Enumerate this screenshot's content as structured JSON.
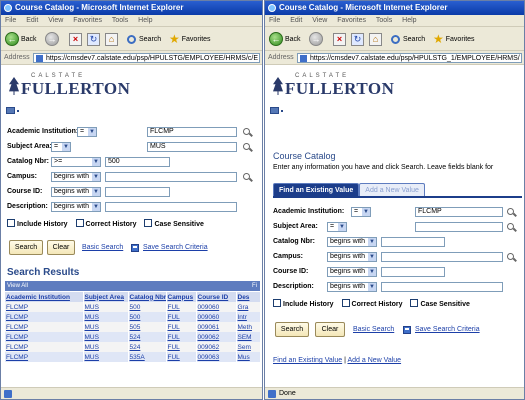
{
  "left_window": {
    "title": "Course Catalog - Microsoft Internet Explorer",
    "menu": [
      "File",
      "Edit",
      "View",
      "Favorites",
      "Tools",
      "Help"
    ],
    "toolbar": {
      "back_label": "Back",
      "search_label": "Search",
      "favorites_label": "Favorites"
    },
    "address": {
      "label": "Address",
      "url": "https://cmsdev7.calstate.edu/psp/HPULSTG/EMPLOYEE/HRMS/c/E"
    },
    "logo": {
      "small": "CALSTATE",
      "big": "FULLERTON"
    },
    "form": {
      "academic_institution": {
        "label": "Academic Institution:",
        "op": "=",
        "value": "FLCMP"
      },
      "subject_area": {
        "label": "Subject Area:",
        "op": "=",
        "value": "MUS"
      },
      "catalog_nbr": {
        "label": "Catalog Nbr:",
        "op": ">=",
        "value": "500"
      },
      "campus": {
        "label": "Campus:",
        "op": "begins with",
        "value": ""
      },
      "course_id": {
        "label": "Course ID:",
        "op": "begins with",
        "value": ""
      },
      "description": {
        "label": "Description:",
        "op": "begins with",
        "value": ""
      }
    },
    "checkboxes": [
      "Include History",
      "Correct History",
      "Case Sensitive"
    ],
    "buttons": {
      "search": "Search",
      "clear": "Clear"
    },
    "links": {
      "basic_search": "Basic Search",
      "save_search": "Save Search Criteria"
    },
    "results": {
      "title": "Search Results",
      "view_all": "View All",
      "columns": [
        "Academic Institution",
        "Subject Area",
        "Catalog Nbr",
        "Campus",
        "Course ID",
        "Des"
      ],
      "rows": [
        [
          "FLCMP",
          "MUS",
          "500",
          "FUL",
          "009060",
          "Gra"
        ],
        [
          "FLCMP",
          "MUS",
          "500",
          "FUL",
          "009060",
          "Intr"
        ],
        [
          "FLCMP",
          "MUS",
          "505",
          "FUL",
          "009061",
          "Meth"
        ],
        [
          "FLCMP",
          "MUS",
          "524",
          "FUL",
          "009062",
          "SEM"
        ],
        [
          "FLCMP",
          "MUS",
          "524",
          "FUL",
          "009062",
          "Sem"
        ],
        [
          "FLCMP",
          "MUS",
          "535A",
          "FUL",
          "009063",
          "Mus"
        ]
      ]
    }
  },
  "right_window": {
    "title": "Course Catalog - Microsoft Internet Explorer",
    "menu": [
      "File",
      "Edit",
      "View",
      "Favorites",
      "Tools",
      "Help"
    ],
    "toolbar": {
      "back_label": "Back",
      "search_label": "Search",
      "favorites_label": "Favorites"
    },
    "address": {
      "label": "Address",
      "url": "https://cmsdev7.calstate.edu/psp/HPULSTG_1/EMPLOYEE/HRMS/"
    },
    "logo": {
      "small": "CALSTATE",
      "big": "FULLERTON"
    },
    "heading": "Course Catalog",
    "help_text": "Enter any information you have and click Search. Leave fields blank for",
    "tabs": {
      "find": "Find an Existing Value",
      "add": "Add a New Value"
    },
    "form": {
      "academic_institution": {
        "label": "Academic Institution:",
        "op": "=",
        "value": "FLCMP"
      },
      "subject_area": {
        "label": "Subject Area:",
        "op": "=",
        "value": ""
      },
      "catalog_nbr": {
        "label": "Catalog Nbr:",
        "op": "begins with",
        "value": ""
      },
      "campus": {
        "label": "Campus:",
        "op": "begins with",
        "value": ""
      },
      "course_id": {
        "label": "Course ID:",
        "op": "begins with",
        "value": ""
      },
      "description": {
        "label": "Description:",
        "op": "begins with",
        "value": ""
      }
    },
    "checkboxes": [
      "Include History",
      "Correct History",
      "Case Sensitive"
    ],
    "buttons": {
      "search": "Search",
      "clear": "Clear"
    },
    "links": {
      "basic_search": "Basic Search",
      "save_search": "Save Search Criteria"
    },
    "bottom_links": {
      "find": "Find an Existing Value",
      "sep": "|",
      "add": "Add a New Value"
    },
    "status": "Done"
  }
}
